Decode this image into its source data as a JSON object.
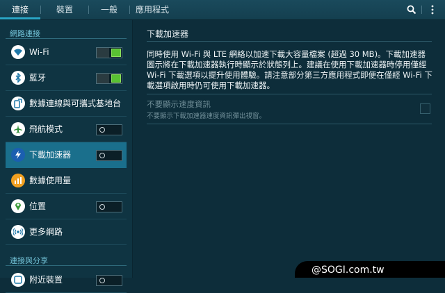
{
  "tabs": [
    {
      "label": "連接"
    },
    {
      "label": "裝置"
    },
    {
      "label": "一般"
    },
    {
      "label": "應用程式"
    }
  ],
  "toolbar_icons": [
    "search-icon",
    "more-vert-icon"
  ],
  "sidebar": {
    "section_network": "網路連接",
    "section_share": "連接與分享",
    "items": [
      {
        "label": "Wi-Fi",
        "icon": "wifi-icon",
        "toggle": "on"
      },
      {
        "label": "藍牙",
        "icon": "bluetooth-icon",
        "toggle": "on"
      },
      {
        "label": "數據連線與可攜式基地台",
        "icon": "tethering-icon",
        "toggle": null
      },
      {
        "label": "飛航模式",
        "icon": "airplane-icon",
        "toggle": "off"
      },
      {
        "label": "下載加速器",
        "icon": "download-booster-icon",
        "toggle": "off",
        "selected": true
      },
      {
        "label": "數據使用量",
        "icon": "data-usage-icon",
        "toggle": null
      },
      {
        "label": "位置",
        "icon": "location-icon",
        "toggle": "off"
      },
      {
        "label": "更多網路",
        "icon": "more-networks-icon",
        "toggle": null
      },
      {
        "label": "附近裝置",
        "icon": "nearby-devices-icon",
        "toggle": "off"
      }
    ]
  },
  "main": {
    "title": "下載加速器",
    "description": "同時使用 Wi-Fi 與 LTE 網絡以加速下載大容量檔案 (超過 30 MB)。下載加速器圖示將在下載加速器執行時顯示於狀態列上。建議在使用下載加速器時停用僅經 Wi-Fi 下載選項以提升使用體驗。請注意部分第三方應用程式即便在僅經 Wi-Fi 下載選項啟用時仍可使用下載加速器。",
    "option": {
      "title": "不要顯示速度資訊",
      "subtitle": "不要顯示下載加速器速度資訊彈出視窗。",
      "checked": false,
      "enabled": false
    }
  },
  "watermark": "@SOGI.com.tw",
  "colors": {
    "accent": "#2aa7c7",
    "selected_bg": "#1a6f8c",
    "toggle_on": "#59c233",
    "background": "#0d2d3a"
  }
}
